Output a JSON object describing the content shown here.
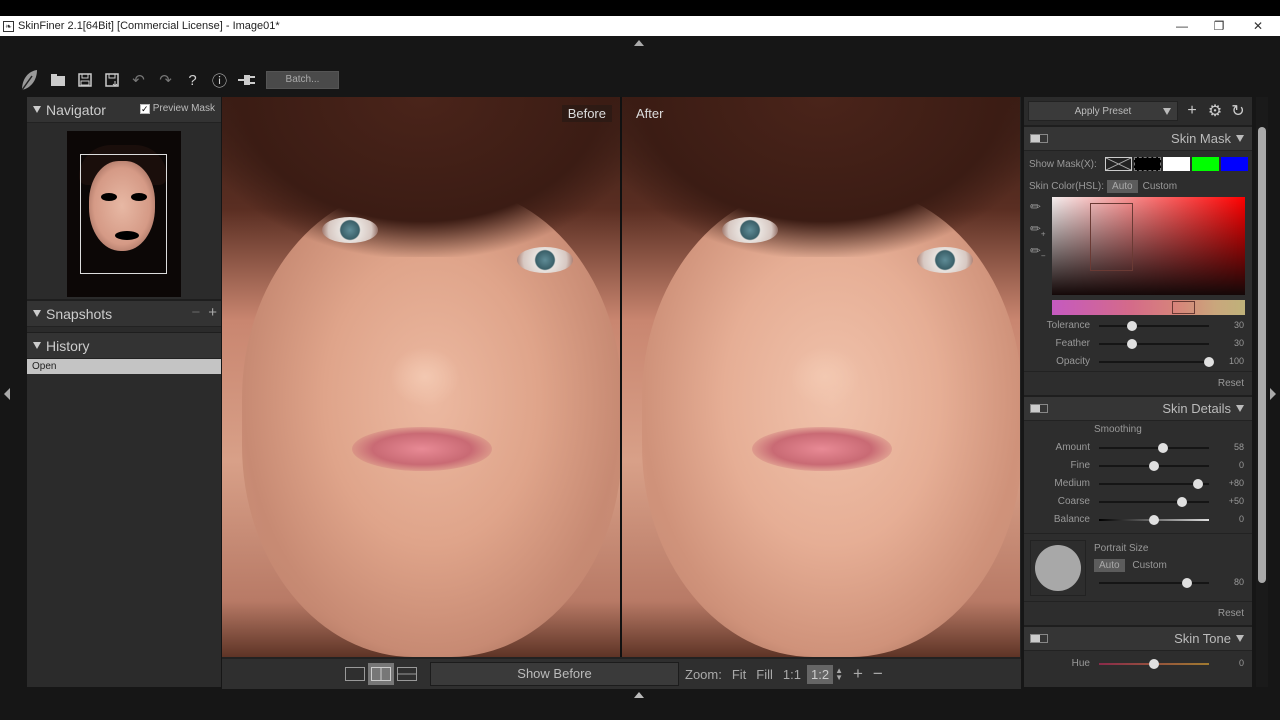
{
  "window": {
    "title": "SkinFiner 2.1[64Bit] [Commercial License] - Image01*",
    "controls": [
      "minimize",
      "restore",
      "close"
    ]
  },
  "toolbar": {
    "icons": [
      "leaf-logo-icon",
      "open-folder-icon",
      "save-icon",
      "save-as-icon",
      "undo-icon",
      "redo-icon",
      "help-icon",
      "info-icon",
      "plugin-icon"
    ],
    "batch_label": "Batch..."
  },
  "left_panel": {
    "navigator": {
      "title": "Navigator",
      "preview_mask_label": "Preview Mask",
      "preview_mask_checked": true
    },
    "snapshots": {
      "title": "Snapshots",
      "minus": "−",
      "plus": "+"
    },
    "history": {
      "title": "History",
      "items": [
        "Open"
      ]
    }
  },
  "viewer": {
    "before_label": "Before",
    "after_label": "After"
  },
  "bottom_bar": {
    "show_before_label": "Show Before",
    "zoom_label": "Zoom:",
    "zoom_options": [
      "Fit",
      "Fill",
      "1:1",
      "1:2"
    ],
    "zoom_selected": "1:2",
    "zoom_in": "+",
    "zoom_out": "−"
  },
  "right_panel": {
    "apply_preset_label": "Apply Preset",
    "skin_mask": {
      "title": "Skin Mask",
      "show_mask_label": "Show Mask(X):",
      "mask_colors": [
        "none",
        "#000000",
        "#ffffff",
        "#00ff00",
        "#0000ff"
      ],
      "skin_color_label": "Skin Color(HSL):",
      "auto_label": "Auto",
      "custom_label": "Custom",
      "sliders": [
        {
          "label": "Tolerance",
          "value": "30",
          "fraction": 0.3
        },
        {
          "label": "Feather",
          "value": "30",
          "fraction": 0.3
        },
        {
          "label": "Opacity",
          "value": "100",
          "fraction": 1.0
        }
      ],
      "reset_label": "Reset"
    },
    "skin_details": {
      "title": "Skin Details",
      "smoothing_label": "Smoothing",
      "sliders": [
        {
          "label": "Amount",
          "value": "58",
          "fraction": 0.58
        },
        {
          "label": "Fine",
          "value": "0",
          "fraction": 0.5
        },
        {
          "label": "Medium",
          "value": "+80",
          "fraction": 0.9
        },
        {
          "label": "Coarse",
          "value": "+50",
          "fraction": 0.75
        },
        {
          "label": "Balance",
          "value": "0",
          "fraction": 0.5
        }
      ],
      "portrait_size_label": "Portrait Size",
      "auto_label": "Auto",
      "custom_label": "Custom",
      "portrait_size_value": "80",
      "portrait_size_fraction": 0.8,
      "reset_label": "Reset"
    },
    "skin_tone": {
      "title": "Skin Tone",
      "sliders": [
        {
          "label": "Hue",
          "value": "0",
          "fraction": 0.5
        }
      ]
    }
  }
}
